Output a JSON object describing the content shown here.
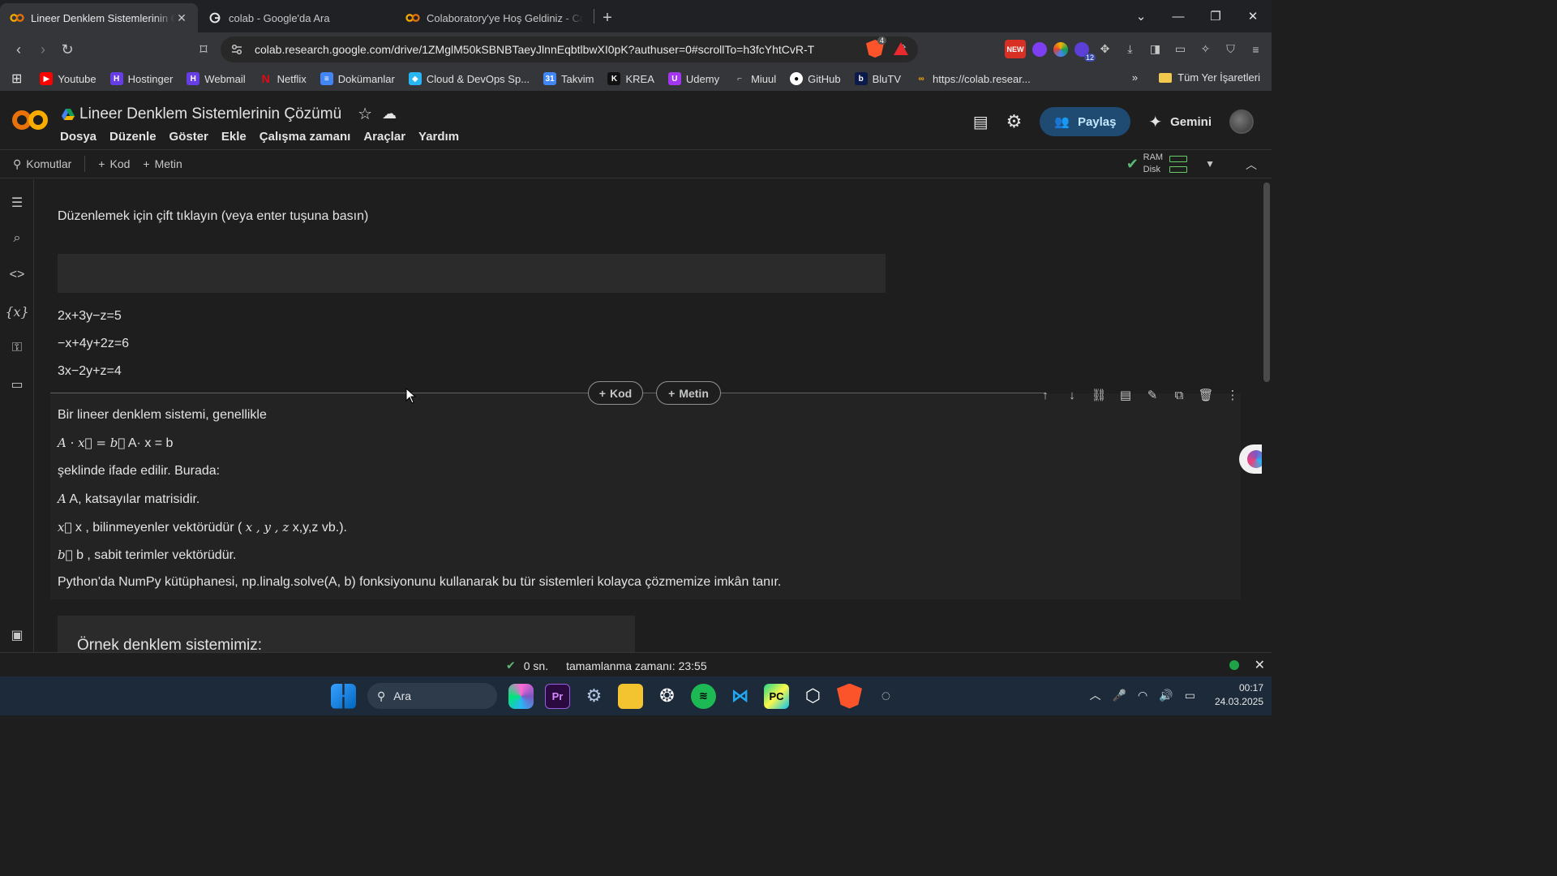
{
  "browser": {
    "tabs": [
      {
        "title": "Lineer Denklem Sistemlerinin Ç",
        "active": true
      },
      {
        "title": "colab - Google'da Ara",
        "active": false
      },
      {
        "title": "Colaboratory'ye Hoş Geldiniz - Cola",
        "active": false
      }
    ],
    "url": "colab.research.google.com/drive/1ZMglM50kSBNBTaeyJlnnEqbtlbwXI0pK?authuser=0#scrollTo=h3fcYhtCvR-T",
    "bookmarks": [
      "Youtube",
      "Hostinger",
      "Webmail",
      "Netflix",
      "Dokümanlar",
      "Cloud & DevOps Sp...",
      "Takvim",
      "KREA",
      "Udemy",
      "Miuul",
      "GitHub",
      "BluTV",
      "https://colab.resear..."
    ],
    "bookmarks_folder": "Tüm Yer İşaretleri",
    "ext_badge_new": "NEW",
    "ext_badge_count": "12",
    "brave_badge": "4"
  },
  "colab": {
    "title": "Lineer Denklem Sistemlerinin Çözümü",
    "menu": [
      "Dosya",
      "Düzenle",
      "Göster",
      "Ekle",
      "Çalışma zamanı",
      "Araçlar",
      "Yardım"
    ],
    "share_label": "Paylaş",
    "gemini_label": "Gemini",
    "actions": {
      "commands": "Komutlar",
      "code": "Kod",
      "text": "Metin"
    },
    "ram_label": "RAM",
    "disk_label": "Disk"
  },
  "notebook": {
    "edit_hint": "Düzenlemek için çift tıklayın (veya enter tuşuna basın)",
    "equations": [
      "2x+3y−z=5",
      "−x+4y+2z=6",
      "3x−2y+z=4"
    ],
    "insert_code": "Kod",
    "insert_text": "Metin",
    "md": {
      "line1": "Bir lineer denklem sistemi, genellikle",
      "line2_math": "A · x⃗ = b⃗",
      "line2_text": "A· x = b",
      "line3": "şeklinde ifade edilir. Burada:",
      "line4_math": "A",
      "line4_text": "A, katsayılar matrisidir.",
      "line5_math": "x⃗",
      "line5_text": "x , bilinmeyenler vektörüdür (",
      "line5_math2": "x , y , z",
      "line5_text2": "x,y,z vb.).",
      "line6_math": "b⃗",
      "line6_text": "b , sabit terimler vektörüdür.",
      "line7": "Python'da NumPy kütüphanesi, np.linalg.solve(A, b) fonksiyonunu kullanarak bu tür sistemleri kolayca çözmemize imkân tanır."
    },
    "example_title": "Örnek denklem sistemimiz:"
  },
  "status": {
    "elapsed": "0 sn.",
    "completed": "tamamlanma zamanı: 23:55"
  },
  "taskbar": {
    "search_label": "Ara",
    "time": "00:17",
    "date": "24.03.2025"
  },
  "colors": {
    "accent": "#1f4b73",
    "colab_orange": "#f9ab00",
    "ok_green": "#5bb974"
  }
}
